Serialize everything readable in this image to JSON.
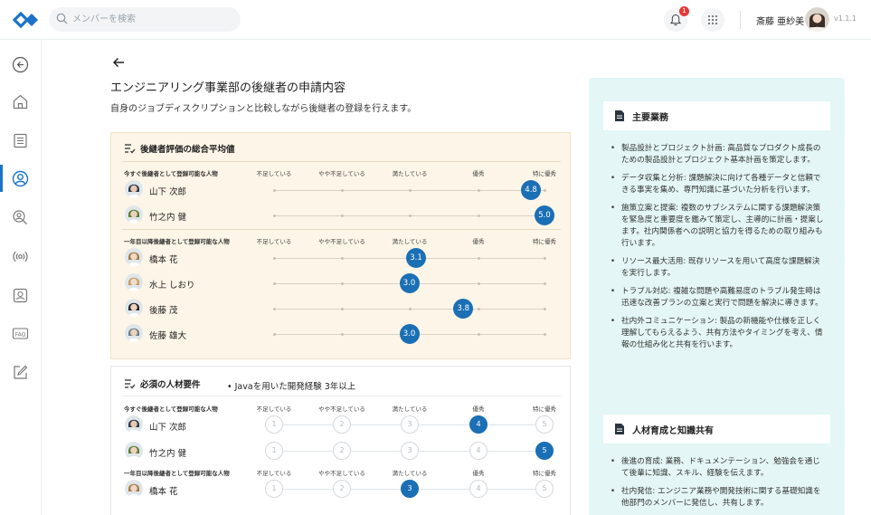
{
  "topbar": {
    "search_placeholder": "メンバーを検索",
    "notification_count": "1",
    "user_name": "斎藤 亜紗美",
    "version": "v1.1.1"
  },
  "page": {
    "title": "エンジニアリング事業部の後継者の申請内容",
    "subtitle": "自身のジョブディスクリプションと比較しながら後継者の登録を行えます。"
  },
  "levels": [
    "不足している",
    "やや不足している",
    "満たしている",
    "優秀",
    "特に優秀"
  ],
  "evaluation": {
    "title": "後継者評価の総合平均値",
    "groups": [
      {
        "label": "今すぐ後継者として登録可能な人物",
        "people": [
          {
            "name": "山下 次郎",
            "score": 4.8,
            "score_label": "4.8"
          },
          {
            "name": "竹之内 健",
            "score": 5.0,
            "score_label": "5.0"
          }
        ]
      },
      {
        "label": "一年目以降後継者として登録可能な人物",
        "people": [
          {
            "name": "橋本 花",
            "score": 3.1,
            "score_label": "3.1"
          },
          {
            "name": "水上 しおり",
            "score": 3.0,
            "score_label": "3.0"
          },
          {
            "name": "後藤 茂",
            "score": 3.8,
            "score_label": "3.8"
          },
          {
            "name": "佐藤 雄大",
            "score": 3.0,
            "score_label": "3.0"
          }
        ]
      }
    ]
  },
  "requirements": {
    "title": "必須の人材要件",
    "item": "Javaを用いた開発経験 3年以上",
    "groups": [
      {
        "label": "今すぐ後継者として登録可能な人物",
        "people": [
          {
            "name": "山下 次郎",
            "selected": 4
          },
          {
            "name": "竹之内 健",
            "selected": 5
          }
        ]
      },
      {
        "label": "一年目以降後継者として登録可能な人物",
        "people": [
          {
            "name": "橋本 花",
            "selected": 3
          }
        ]
      }
    ]
  },
  "job_description": {
    "sections": [
      {
        "title": "主要業務",
        "items": [
          "製品設計とプロジェクト計画: 高品質なプロダクト成長のための製品設計とプロジェクト基本計画を策定します。",
          "データ収集と分析: 課題解決に向けて各種データと信頼できる事実を集め、専門知識に基づいた分析を行います。",
          "施策立案と提案: 複数のサブシステムに関する課題解決策を緊急度と重要度を鑑みて策定し、主導的に計画・提案します。社内関係者への説明と協力を得るための取り組みも行います。",
          "リソース最大活用: 既存リソースを用いて高度な課題解決を実行します。",
          "トラブル対応: 複雑な問題や高難易度のトラブル発生時は迅速な改善プランの立案と実行で問題を解決に導きます。",
          "社内外コミュニケーション: 製品の新機能や仕様を正しく理解してもらえるよう、共有方法やタイミングを考え、情報の仕組み化と共有を行います。"
        ]
      },
      {
        "title": "人材育成と知識共有",
        "items": [
          "後進の育成: 業務、ドキュメンテーション、勉強会を通じて後輩に知識、スキル、経験を伝えます。",
          "社内発信: エンジニア業務や開発技術に関する基礎知識を他部門のメンバーに発信し、共有します。"
        ]
      }
    ]
  },
  "colors": {
    "accent": "#1a6fb5",
    "eval_bg": "#fdf5e7",
    "panel_bg": "#e4f6f6",
    "badge": "#e23b3b"
  }
}
